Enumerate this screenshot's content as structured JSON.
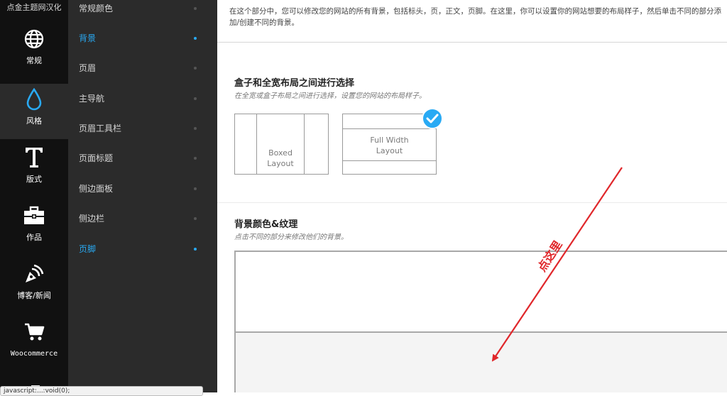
{
  "sidebar": {
    "brand": "点金主题网汉化",
    "items": [
      {
        "label": "常规",
        "icon": "globe-icon"
      },
      {
        "label": "风格",
        "icon": "water-drop-icon"
      },
      {
        "label": "版式",
        "icon": "typography-icon"
      },
      {
        "label": "作品",
        "icon": "briefcase-icon"
      },
      {
        "label": "博客/新闻",
        "icon": "pen-nib-icon"
      },
      {
        "label": "Woocommerce",
        "icon": "cart-icon"
      }
    ]
  },
  "subnav": {
    "items": [
      {
        "label": "常规颜色"
      },
      {
        "label": "背景"
      },
      {
        "label": "页眉"
      },
      {
        "label": "主导航"
      },
      {
        "label": "页眉工具栏"
      },
      {
        "label": "页面标题"
      },
      {
        "label": "侧边面板"
      },
      {
        "label": "侧边栏"
      },
      {
        "label": "页脚"
      }
    ]
  },
  "content": {
    "intro": "在这个部分中，您可以修改您的网站的所有背景，包括标头，页，正文，页脚。在这里，你可以设置你的网站想要的布局样子，然后单击不同的部分添加/创建不同的背景。",
    "layout_section": {
      "title": "盒子和全宽布局之间进行选择",
      "desc": "在全宽或盒子布局之间进行选择，设置您的网站的布局样子。",
      "options": [
        {
          "line1": "Boxed",
          "line2": "Layout"
        },
        {
          "line1": "Full Width",
          "line2": "Layout"
        }
      ]
    },
    "bg_section": {
      "title": "背景颜色&纹理",
      "desc": "点击不同的部分来修改他们的背景。"
    }
  },
  "annotation": {
    "text": "点这里"
  },
  "tooltip": {
    "text": "javascript:...:void(0);"
  },
  "colors": {
    "accent": "#29aaf4",
    "arrow": "#e0272b",
    "rail_bg": "#111111",
    "panel_bg": "#2b2b2b"
  }
}
